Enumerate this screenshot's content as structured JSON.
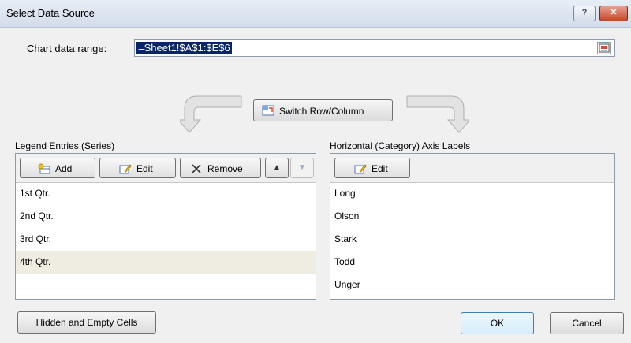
{
  "window": {
    "title": "Select Data Source",
    "help_label": "?",
    "close_label": "✕"
  },
  "range": {
    "label": "Chart data range:",
    "value": "=Sheet1!$A$1:$E$6"
  },
  "switch_button": {
    "label": "Switch Row/Column"
  },
  "legend": {
    "group_label": "Legend Entries (Series)",
    "add_label": "Add",
    "edit_label": "Edit",
    "remove_label": "Remove",
    "up_label": "▲",
    "down_label": "▼",
    "items": [
      "1st Qtr.",
      "2nd Qtr.",
      "3rd Qtr.",
      "4th Qtr."
    ],
    "selected_index": 3
  },
  "axis": {
    "group_label": "Horizontal (Category) Axis Labels",
    "edit_label": "Edit",
    "items": [
      "Long",
      "Olson",
      "Stark",
      "Todd",
      "Unger"
    ]
  },
  "footer": {
    "hidden_cells_label": "Hidden and Empty Cells",
    "ok_label": "OK",
    "cancel_label": "Cancel"
  }
}
